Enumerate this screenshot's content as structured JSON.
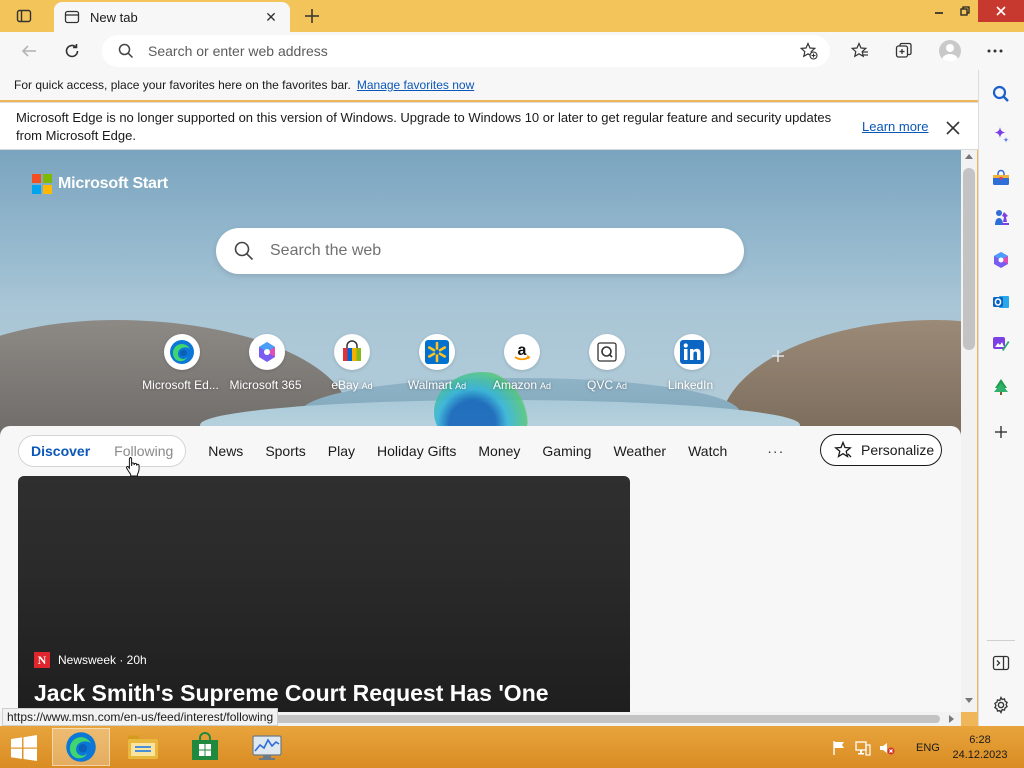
{
  "browser": {
    "tab_title": "New tab",
    "address_placeholder": "Search or enter web address",
    "favorites_message": "For quick access, place your favorites here on the favorites bar.",
    "favorites_link": "Manage favorites now",
    "info_message": "Microsoft Edge is no longer supported on this version of Windows. Upgrade to Windows 10 or later to get regular feature and security updates from Microsoft Edge.",
    "info_link": "Learn more",
    "status_url": "https://www.msn.com/en-us/feed/interest/following"
  },
  "start": {
    "brand": "Microsoft Start",
    "search_placeholder": "Search the web",
    "tiles": [
      {
        "label": "Microsoft Ed...",
        "ad": "",
        "icon": "edge-icon"
      },
      {
        "label": "Microsoft 365",
        "ad": "",
        "icon": "microsoft-365-icon"
      },
      {
        "label": "eBay",
        "ad": "Ad",
        "icon": "ebay-icon"
      },
      {
        "label": "Walmart",
        "ad": "Ad",
        "icon": "walmart-icon"
      },
      {
        "label": "Amazon",
        "ad": "Ad",
        "icon": "amazon-icon"
      },
      {
        "label": "QVC",
        "ad": "Ad",
        "icon": "qvc-icon"
      },
      {
        "label": "LinkedIn",
        "ad": "",
        "icon": "linkedin-icon"
      }
    ]
  },
  "feed": {
    "discover": "Discover",
    "following": "Following",
    "nav": [
      "News",
      "Sports",
      "Play",
      "Holiday Gifts",
      "Money",
      "Gaming",
      "Weather",
      "Watch"
    ],
    "more": "···",
    "personalize": "Personalize",
    "card": {
      "source_logo": "N",
      "source": "Newsweek · 20h",
      "headline": "Jack Smith's Supreme Court Request Has 'One"
    }
  },
  "taskbar": {
    "language": "ENG",
    "time": "6:28",
    "date": "24.12.2023"
  },
  "colors": {
    "title_bar": "#f2c45a",
    "taskbar": "#e09a30",
    "link": "#0b57b8",
    "accent_discover": "#0b57b8"
  }
}
